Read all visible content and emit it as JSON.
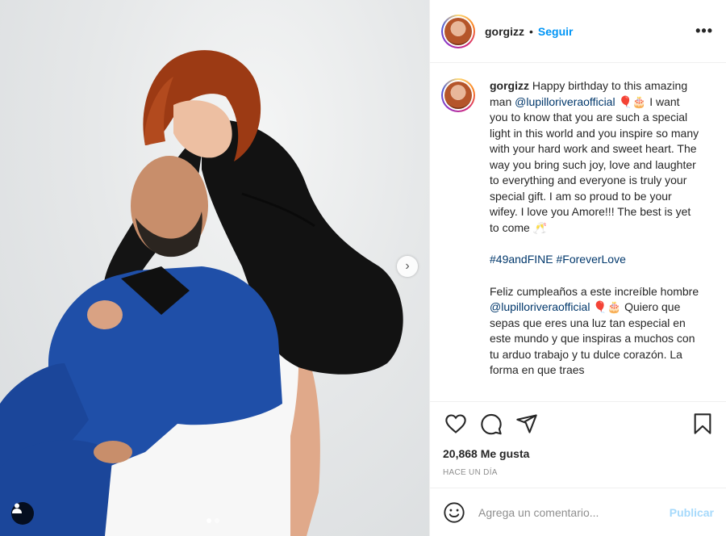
{
  "post": {
    "username": "gorgizz",
    "separator": "•",
    "follow_label": "Seguir",
    "more_label": "•••"
  },
  "caption": {
    "username": "gorgizz",
    "part1": " Happy birthday to this amazing man ",
    "mention1": "@lupilloriveraofficial",
    "part2": " 🎈🎂 I want you to know that you are such a special light in this world and you inspire so many with your hard work and sweet heart. The way you bring such joy, love and laughter to everything and everyone is truly your special gift. I am so proud to be your wifey. I love you Amore!!! The best is yet to come 🥂",
    "hashtag1": "#49andFINE",
    "hashtag2": "#ForeverLove",
    "spanish1": "Feliz cumpleaños a este increíble hombre ",
    "mention2": "@lupilloriveraofficial",
    "spanish2": " 🎈🎂 Quiero que sepas que eres una luz tan especial en este mundo y que inspiras a muchos con tu arduo trabajo y tu dulce corazón. La forma en que traes"
  },
  "stats": {
    "likes": "20,868 Me gusta",
    "date": "HACE UN DÍA"
  },
  "comment_box": {
    "placeholder": "Agrega un comentario...",
    "publish_label": "Publicar"
  },
  "carousel": {
    "next_label": "›",
    "slides": 2,
    "active_slide": 1
  },
  "colors": {
    "accent": "#0095f6",
    "link": "#00376b",
    "muted": "#8e8e8e"
  },
  "icons": [
    "heart-icon",
    "comment-icon",
    "share-icon",
    "bookmark-icon",
    "emoji-icon",
    "user-tag-icon",
    "chevron-right-icon",
    "more-icon"
  ]
}
